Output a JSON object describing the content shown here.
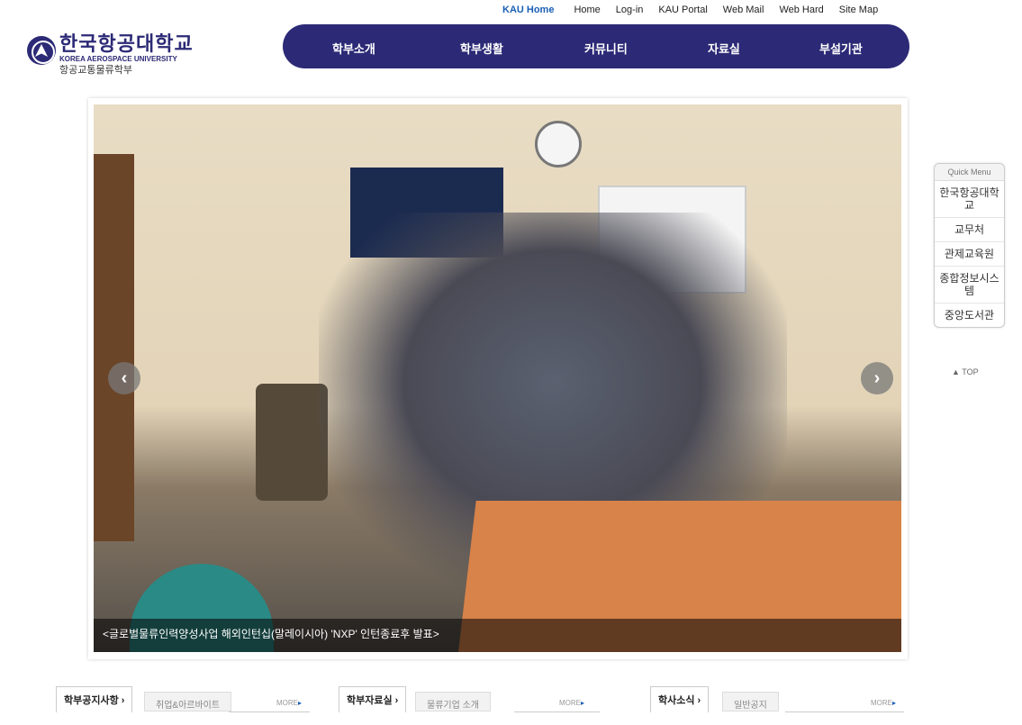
{
  "top_links": [
    "KAU Home",
    "Home",
    "Log-in",
    "KAU Portal",
    "Web Mail",
    "Web Hard",
    "Site Map"
  ],
  "logo": {
    "korean": "한국항공대학교",
    "english": "KOREA AEROSPACE UNIVERSITY",
    "department": "항공교통물류학부"
  },
  "nav": [
    "학부소개",
    "학부생활",
    "커뮤니티",
    "자료실",
    "부설기관"
  ],
  "slider": {
    "caption": "<글로벌물류인력양성사업 해외인턴십(말레이시아) 'NXP' 인턴종료후 발표>",
    "prev_icon": "‹",
    "next_icon": "›"
  },
  "quick_menu": {
    "title": "Quick Menu",
    "items": [
      "한국항공대학교",
      "교무처",
      "관제교육원",
      "종합정보시스템",
      "중앙도서관"
    ],
    "top": "▲ TOP"
  },
  "boards": [
    {
      "active": "학부공지사항 ›",
      "inactive": "취업&아르바이트",
      "more": "MORE"
    },
    {
      "active": "학부자료실 ›",
      "inactive": "물류기업 소개",
      "more": "MORE"
    },
    {
      "active": "학사소식 ›",
      "inactive": "일반공지",
      "more": "MORE"
    }
  ],
  "colors": {
    "brand": "#2c2a76",
    "link_accent": "#1a5fb4"
  }
}
